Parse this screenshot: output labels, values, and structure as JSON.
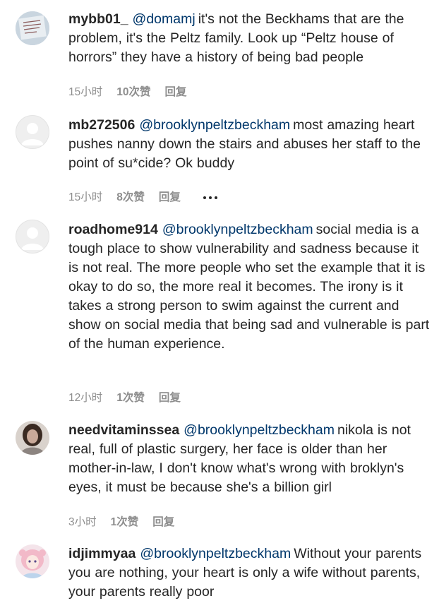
{
  "comments": [
    {
      "username": "mybb01_",
      "mention": "@domamj",
      "text": "it's not the Beckhams that are the problem, it's the Peltz family. Look up “Peltz house of horrors” they have a history of being bad people",
      "time": "15小时",
      "likes": "10次赞",
      "reply": "回复",
      "avatar": "photo-sign"
    },
    {
      "username": "mb272506",
      "mention": "@brooklynpeltzbeckham",
      "text": "most amazing heart pushes nanny down the stairs and abuses her staff to the point of su*cide? Ok buddy",
      "time": "15小时",
      "likes": "8次赞",
      "reply": "回复",
      "avatar": "default"
    },
    {
      "username": "roadhome914",
      "mention": "@brooklynpeltzbeckham",
      "text": "social media is a tough place to show vulnerability and sadness because it is not real. The more people who set the example that it is okay to do so, the more real it becomes. The irony is it takes a strong person to swim against the current and show on social media that being sad and vulnerable is part of the human experience.",
      "time": "12小时",
      "likes": "1次赞",
      "reply": "回复",
      "avatar": "default"
    },
    {
      "username": "needvitaminssea",
      "mention": "@brooklynpeltzbeckham",
      "text": "nikola is not real, full of plastic surgery, her face is older than her mother-in-law, I don't know what's wrong with broklyn's eyes, it must be because she's a billion girl",
      "time": "3小时",
      "likes": "1次赞",
      "reply": "回复",
      "avatar": "photo-portrait"
    },
    {
      "username": "idjimmyaa",
      "mention": "@brooklynpeltzbeckham",
      "text": "Without your parents you are nothing, your heart is only a wife without parents, your parents really poor",
      "avatar": "photo-anime"
    }
  ],
  "colors": {
    "text": "#262626",
    "mention": "#00376b",
    "meta": "#8e8e8e"
  }
}
